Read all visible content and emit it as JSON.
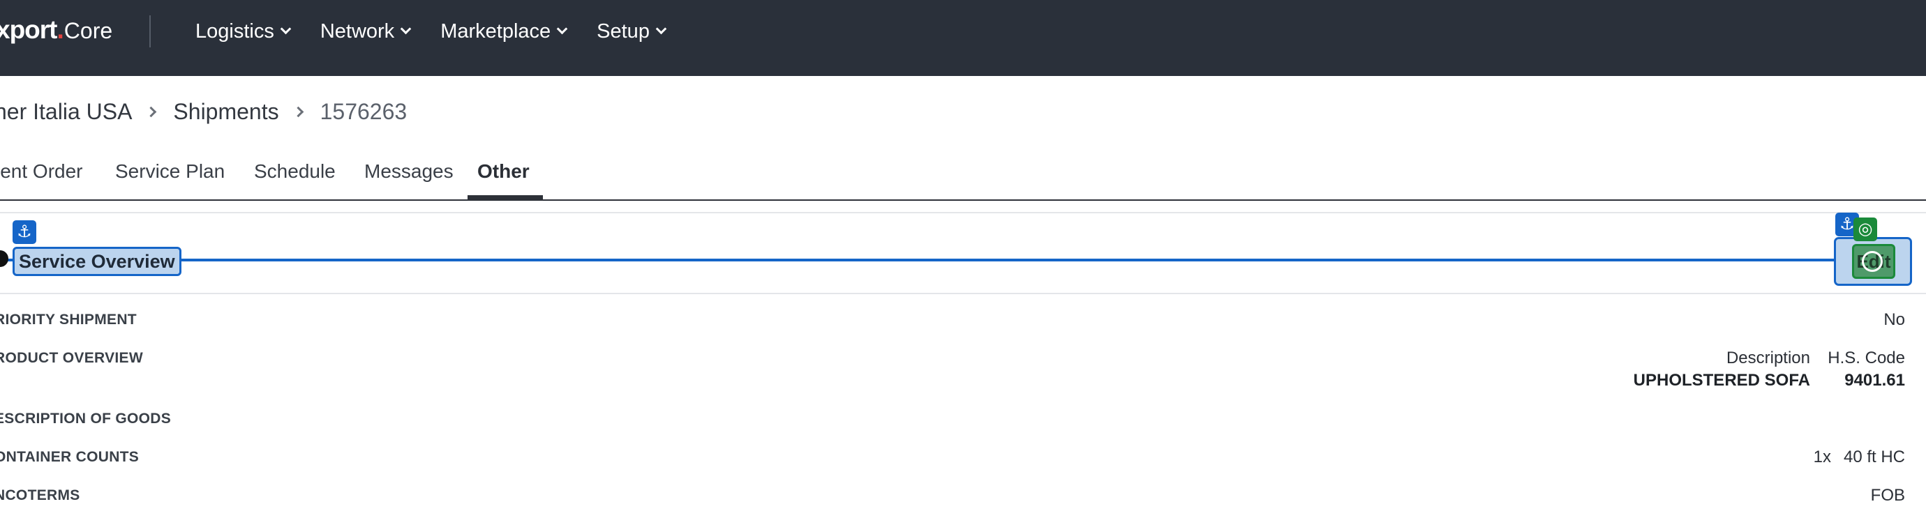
{
  "header": {
    "logo_brand": "xport",
    "logo_dot": ".",
    "logo_product": "Core",
    "nav": [
      {
        "label": "Logistics"
      },
      {
        "label": "Network"
      },
      {
        "label": "Marketplace"
      },
      {
        "label": "Setup"
      }
    ]
  },
  "breadcrumb": {
    "items": [
      "her Italia USA",
      "Shipments",
      "1576263"
    ]
  },
  "tabs": [
    {
      "label": "ient Order"
    },
    {
      "label": "Service Plan"
    },
    {
      "label": "Schedule"
    },
    {
      "label": "Messages"
    },
    {
      "label": "Other",
      "active": true
    }
  ],
  "section": {
    "title": "Service Overview",
    "edit_label": "Edit"
  },
  "overlay": {
    "anchor_icon": "anchor-icon",
    "anchor_glyph": "⚓",
    "target_icon": "target-icon",
    "target_glyph": "◎",
    "line_color": "#1565c8",
    "target_color": "#1b8a3a"
  },
  "fields": {
    "priority": {
      "label": "RIORITY SHIPMENT",
      "value": "No"
    },
    "product": {
      "label": "RODUCT OVERVIEW",
      "col_description": "Description",
      "col_hs": "H.S. Code",
      "description": "UPHOLSTERED SOFA",
      "hs_code": "9401.61"
    },
    "goods": {
      "label": "ESCRIPTION OF GOODS"
    },
    "containers": {
      "label": "ONTAINER COUNTS",
      "count": "1x",
      "type": "40 ft HC"
    },
    "incoterms": {
      "label": "NCOTERMS",
      "value": "FOB"
    }
  },
  "colors": {
    "topbar": "#2a303a",
    "accent_red": "#e0413e"
  }
}
